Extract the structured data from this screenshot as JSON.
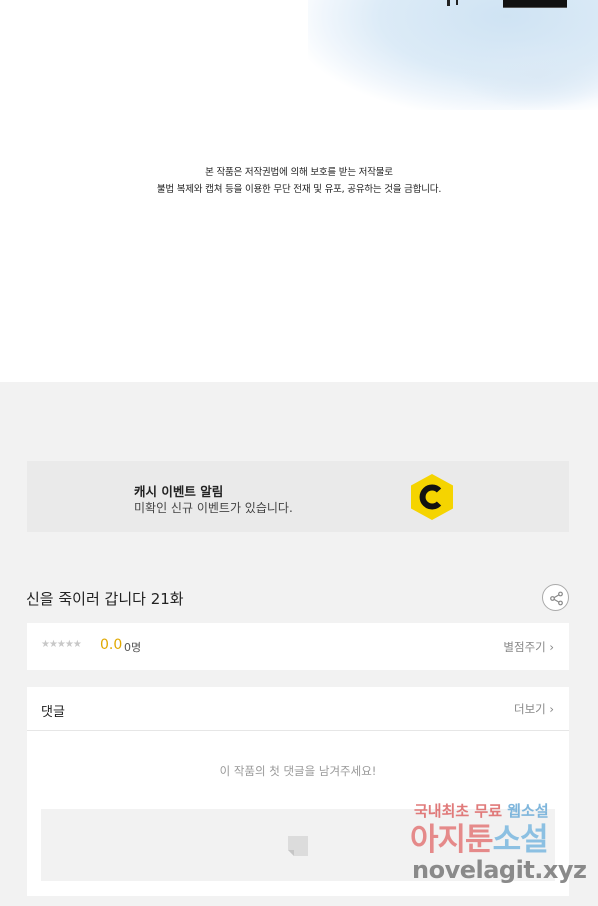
{
  "notice": {
    "line1": "본 작품은 저작권법에 의해 보호를 받는 저작물로",
    "line2": "불법 복제와 캡쳐 등을 이용한 무단 전재 및 유포, 공유하는 것을 금합니다."
  },
  "banner": {
    "title": "캐시 이벤트 알림",
    "subtitle": "미확인 신규 이벤트가 있습니다.",
    "logo_icon": "cash-c-logo-icon",
    "logo_color": "#f5d400"
  },
  "episode": {
    "title": "신을 죽이러 갑니다 21화",
    "share_icon": "share-icon"
  },
  "rating": {
    "stars": "★★★★★",
    "score": "0.0",
    "count": "0명",
    "rate_link": "별점주기",
    "score_color": "#e0a800"
  },
  "comments": {
    "title": "댓글",
    "more_link": "더보기",
    "empty_message": "이 작품의 첫 댓글을 남겨주세요!",
    "input_icon": "comment-input-icon"
  },
  "watermark": {
    "line1_a": "국내최초 무료 ",
    "line1_b": "웹소설",
    "line2_a": "아지툰",
    "line2_b": "소설",
    "line3": "novelagit.xyz"
  }
}
